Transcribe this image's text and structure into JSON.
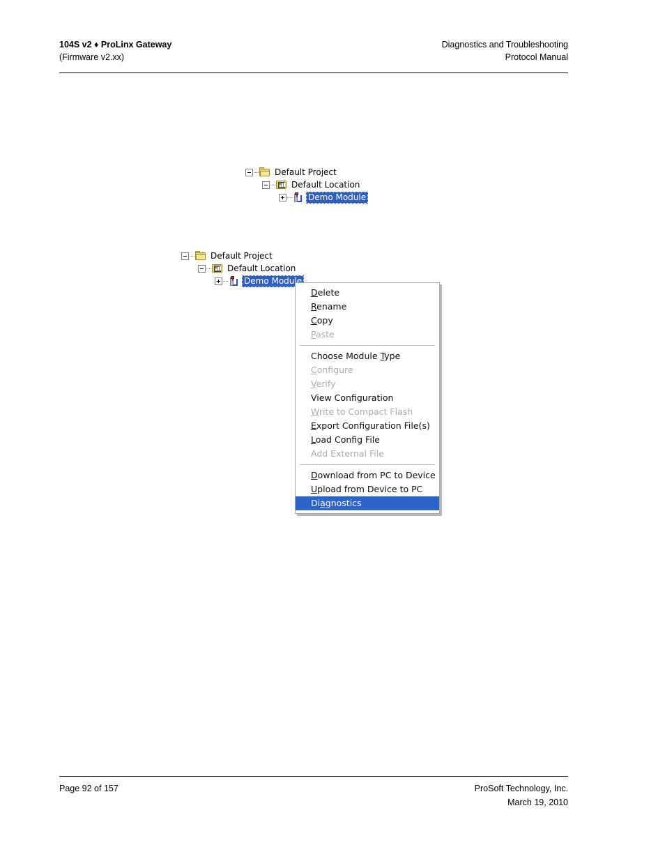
{
  "header": {
    "left_line_1": "104S v2 ♦ ProLinx Gateway",
    "left_line_2": "(Firmware v2.xx)",
    "right_line_1": "Diagnostics and Troubleshooting",
    "right_line_2": "Protocol Manual"
  },
  "footer": {
    "page_label": "Page 92 of 157",
    "company": "ProSoft Technology, Inc.",
    "date": "March 19, 2010"
  },
  "tree_top": {
    "nodes": [
      {
        "label": "Default Project",
        "icon": "folder-icon",
        "expander": "minus"
      },
      {
        "label": "Default Location",
        "icon": "folder-location-icon",
        "expander": "minus"
      },
      {
        "label": "Demo Module",
        "icon": "module-icon",
        "expander": "plus",
        "selected": true
      }
    ]
  },
  "tree_bottom": {
    "nodes": [
      {
        "label": "Default Project",
        "icon": "folder-icon",
        "expander": "minus"
      },
      {
        "label": "Default Location",
        "icon": "folder-location-icon",
        "expander": "minus"
      },
      {
        "label": "Demo Module",
        "icon": "module-icon",
        "expander": "plus",
        "selected": true
      }
    ]
  },
  "context_menu": {
    "groups": [
      {
        "items": [
          {
            "accel": "D",
            "rest": "elete",
            "pre": "",
            "label": "Delete",
            "disabled": false,
            "selected": false
          },
          {
            "accel": "R",
            "rest": "ename",
            "pre": "",
            "label": "Rename",
            "disabled": false,
            "selected": false
          },
          {
            "accel": "C",
            "rest": "opy",
            "pre": "",
            "label": "Copy",
            "disabled": false,
            "selected": false
          },
          {
            "accel": "P",
            "rest": "aste",
            "pre": "",
            "label": "Paste",
            "disabled": true,
            "selected": false
          }
        ]
      },
      {
        "items": [
          {
            "accel": "T",
            "rest": "ype",
            "pre": "Choose Module ",
            "label": "Choose Module Type",
            "disabled": false,
            "selected": false
          },
          {
            "accel": "C",
            "rest": "onfigure",
            "pre": "",
            "label": "Configure",
            "disabled": true,
            "selected": false
          },
          {
            "accel": "V",
            "rest": "erify",
            "pre": "",
            "label": "Verify",
            "disabled": true,
            "selected": false
          },
          {
            "accel": "g",
            "rest": "uration",
            "pre": "View Confi",
            "label": "View Configuration",
            "disabled": false,
            "selected": false
          },
          {
            "accel": "W",
            "rest": "rite to Compact Flash",
            "pre": "",
            "label": "Write to Compact Flash",
            "disabled": true,
            "selected": false
          },
          {
            "accel": "E",
            "rest": "xport Configuration File(s)",
            "pre": "",
            "label": "Export Configuration File(s)",
            "disabled": false,
            "selected": false
          },
          {
            "accel": "L",
            "rest": "oad Config File",
            "pre": "",
            "label": "Load Config File",
            "disabled": false,
            "selected": false
          },
          {
            "accel": "",
            "rest": "",
            "pre": "Add External File",
            "label": "Add External File",
            "disabled": true,
            "selected": false
          }
        ]
      },
      {
        "items": [
          {
            "accel": "D",
            "rest": "ownload from PC to Device",
            "pre": "",
            "label": "Download from PC to Device",
            "disabled": false,
            "selected": false
          },
          {
            "accel": "U",
            "rest": "pload from Device to PC",
            "pre": "",
            "label": "Upload from Device to PC",
            "disabled": false,
            "selected": false
          },
          {
            "accel": "a",
            "rest": "gnostics",
            "pre": "Di",
            "label": "Diagnostics",
            "disabled": false,
            "selected": true
          }
        ]
      }
    ]
  },
  "colors": {
    "selection_blue": "#2b5fc4",
    "menu_highlight_blue": "#2e63c8",
    "menu_border": "#a9a9a9",
    "disabled_text": "#acacac",
    "folder_yellow": "#ead87a"
  }
}
